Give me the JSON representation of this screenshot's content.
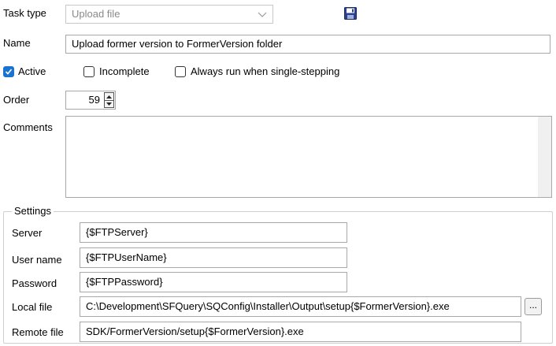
{
  "task_type": {
    "label": "Task type",
    "value": "Upload file"
  },
  "name": {
    "label": "Name",
    "value": "Upload former version to FormerVersion folder"
  },
  "flags": {
    "active": {
      "label": "Active",
      "checked": true
    },
    "incomplete": {
      "label": "Incomplete",
      "checked": false
    },
    "always_run": {
      "label": "Always run when single-stepping",
      "checked": false
    }
  },
  "order": {
    "label": "Order",
    "value": "59"
  },
  "comments": {
    "label": "Comments",
    "value": ""
  },
  "settings": {
    "title": "Settings",
    "server": {
      "label": "Server",
      "value": "{$FTPServer}"
    },
    "user_name": {
      "label": "User name",
      "value": "{$FTPUserName}"
    },
    "password": {
      "label": "Password",
      "value": "{$FTPPassword}"
    },
    "local_file": {
      "label": "Local file",
      "value": "C:\\Development\\SFQuery\\SQConfig\\Installer\\Output\\setup{$FormerVersion}.exe",
      "browse_label": "..."
    },
    "remote_file": {
      "label": "Remote file",
      "value": "SDK/FormerVersion/setup{$FormerVersion}.exe"
    }
  },
  "colors": {
    "accent": "#1a73d1",
    "save_icon": "#2b3f8c"
  },
  "icons": {
    "save": "floppy-disk-icon",
    "dropdown": "chevron-down-icon",
    "check": "checkmark-icon"
  }
}
